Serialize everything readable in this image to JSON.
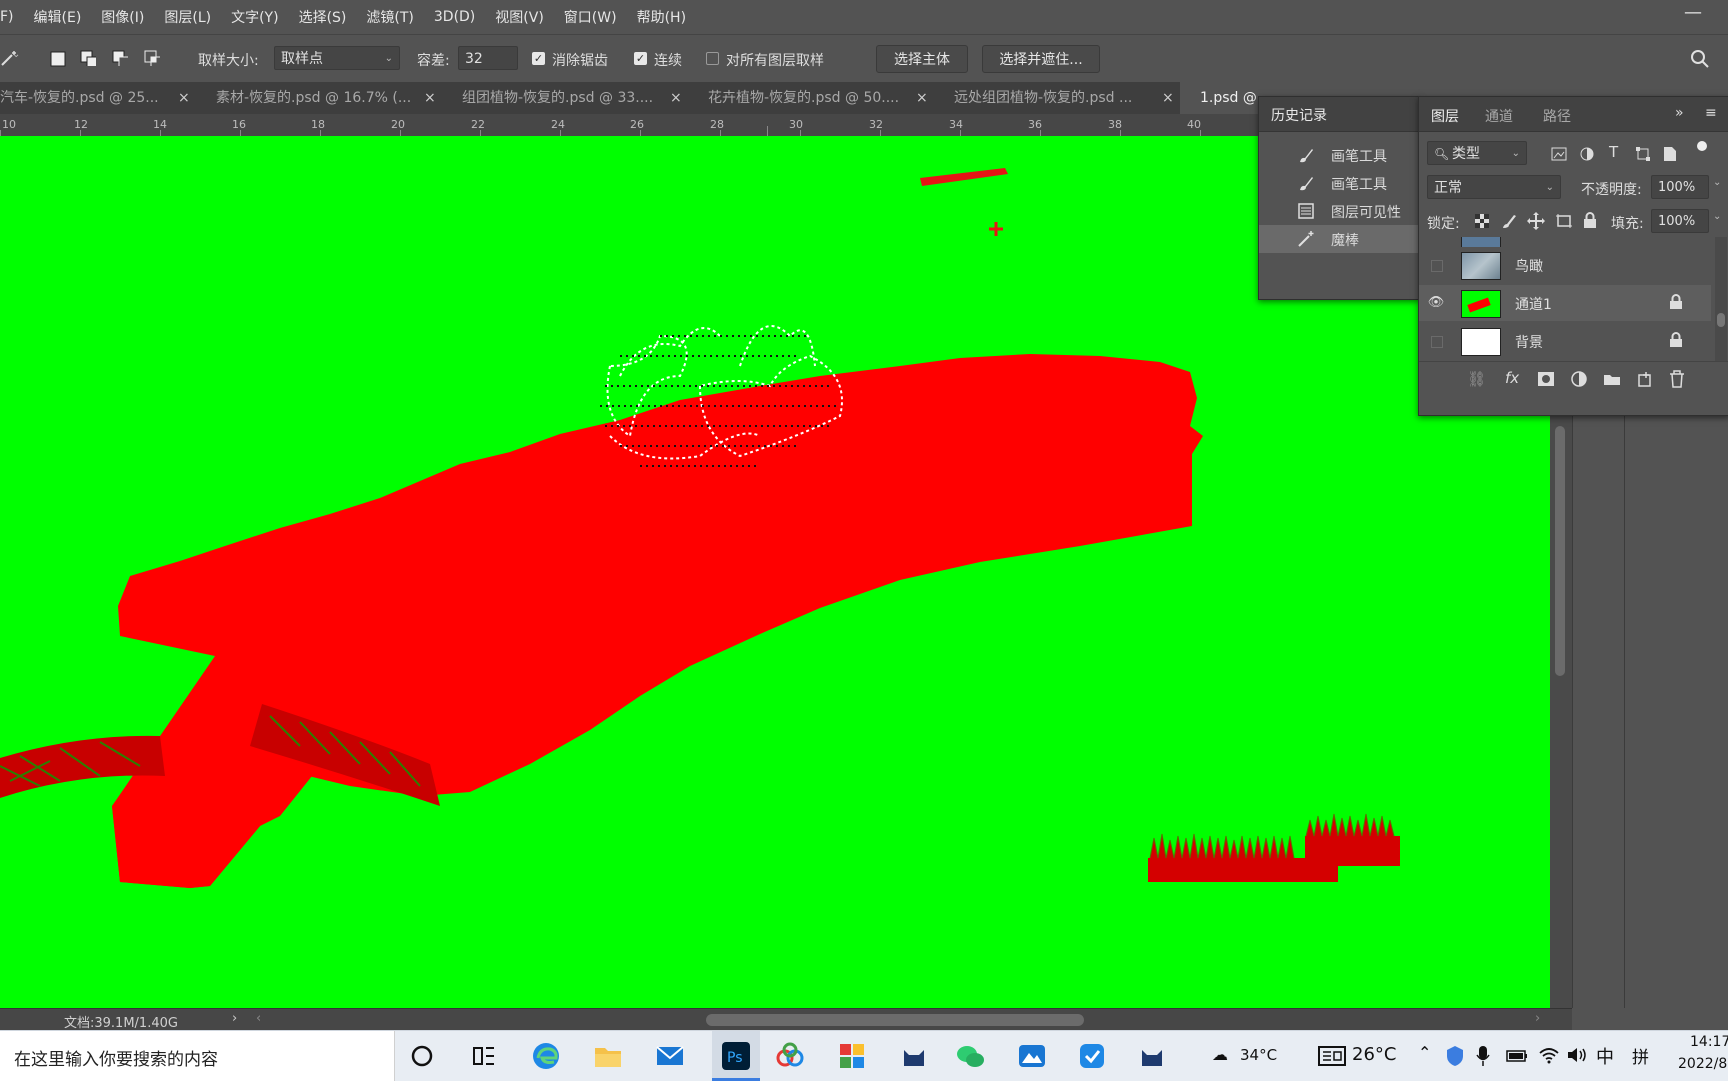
{
  "menu": [
    "F)",
    "编辑(E)",
    "图像(I)",
    "图层(L)",
    "文字(Y)",
    "选择(S)",
    "滤镜(T)",
    "3D(D)",
    "视图(V)",
    "窗口(W)",
    "帮助(H)"
  ],
  "options": {
    "sample_size_label": "取样大小:",
    "sample_size_value": "取样点",
    "tolerance_label": "容差:",
    "tolerance_value": "32",
    "anti_alias_label": "消除锯齿",
    "contiguous_label": "连续",
    "sample_all_layers_label": "对所有图层取样",
    "select_subject_label": "选择主体",
    "select_and_mask_label": "选择并遮住..."
  },
  "tabs": [
    {
      "label": "汽车-恢复的.psd @ 25...",
      "close": "×"
    },
    {
      "label": "素材-恢复的.psd @ 16.7% (...",
      "close": "×"
    },
    {
      "label": "组团植物-恢复的.psd @ 33....",
      "close": "×"
    },
    {
      "label": "花卉植物-恢复的.psd @ 50....",
      "close": "×"
    },
    {
      "label": "远处组团植物-恢复的.psd ...",
      "close": "×"
    },
    {
      "label": "1.psd @",
      "close": ""
    }
  ],
  "ruler_ticks": [
    "10",
    "12",
    "14",
    "16",
    "18",
    "20",
    "22",
    "24",
    "26",
    "28",
    "30",
    "32",
    "34",
    "36",
    "38",
    "40"
  ],
  "history": {
    "title": "历史记录",
    "items": [
      {
        "label": "画笔工具",
        "icon": "brush-icon"
      },
      {
        "label": "画笔工具",
        "icon": "brush-icon"
      },
      {
        "label": "图层可见性",
        "icon": "layer-visibility-icon"
      },
      {
        "label": "魔棒",
        "icon": "magic-wand-icon"
      }
    ],
    "selected_index": 3
  },
  "layers": {
    "tabs": [
      "图层",
      "通道",
      "路径"
    ],
    "filter_label": "类型",
    "blend_mode": "正常",
    "opacity_label": "不透明度:",
    "opacity_value": "100%",
    "lock_label": "锁定:",
    "fill_label": "填充:",
    "fill_value": "100%",
    "items": [
      {
        "name": "鸟瞰",
        "visible": false,
        "locked": false
      },
      {
        "name": "通道1",
        "visible": true,
        "locked": true
      },
      {
        "name": "背景",
        "visible": false,
        "locked": true
      }
    ]
  },
  "status": {
    "doc": "文档:39.1M/1.40G"
  },
  "taskbar": {
    "search_placeholder": "在这里输入你要搜索的内容",
    "weather_temp": "34°C",
    "weather_temp2": "26°C",
    "ime_lang": "中",
    "ime_mode": "拼",
    "time": "14:17",
    "date": "2022/8"
  },
  "colors": {
    "canvas_bg": "#00ff00",
    "shape_red": "#ff0000",
    "ui_bg": "#535353"
  }
}
